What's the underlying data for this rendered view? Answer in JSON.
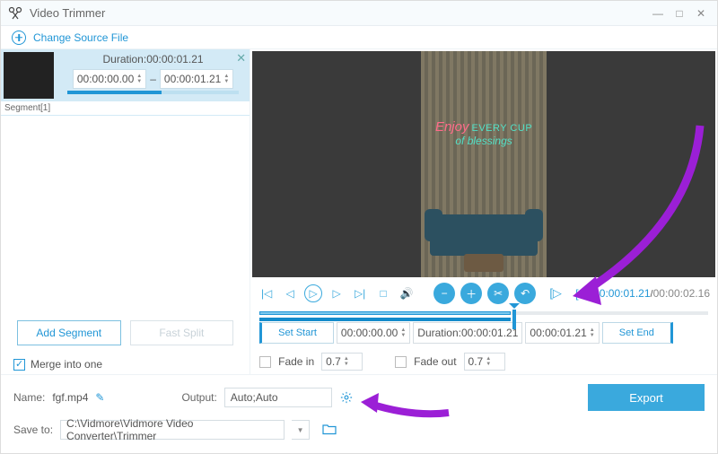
{
  "title": "Video Trimmer",
  "change_source": "Change Source File",
  "segment": {
    "label": "Segment[1]",
    "duration_label": "Duration:",
    "duration": "00:00:01.21",
    "start": "00:00:00.00",
    "end": "00:00:01.21"
  },
  "buttons": {
    "add_segment": "Add Segment",
    "fast_split": "Fast Split",
    "merge": "Merge into one",
    "set_start": "Set Start",
    "set_end": "Set End",
    "export": "Export"
  },
  "time": {
    "current": "00:00:01.21",
    "total": "00:00:02.16"
  },
  "trim": {
    "start": "00:00:00.00",
    "dur_label": "Duration:",
    "duration": "00:00:01.21",
    "end": "00:00:01.21"
  },
  "fade": {
    "in_label": "Fade in",
    "in_val": "0.7",
    "out_label": "Fade out",
    "out_val": "0.7"
  },
  "name": {
    "label": "Name:",
    "value": "fgf.mp4"
  },
  "output": {
    "label": "Output:",
    "value": "Auto;Auto"
  },
  "save": {
    "label": "Save to:",
    "path": "C:\\Vidmore\\Vidmore Video Converter\\Trimmer"
  },
  "neon": {
    "l1": "Enjoy",
    "l2": "EVERY CUP",
    "l3": "of blessings"
  }
}
